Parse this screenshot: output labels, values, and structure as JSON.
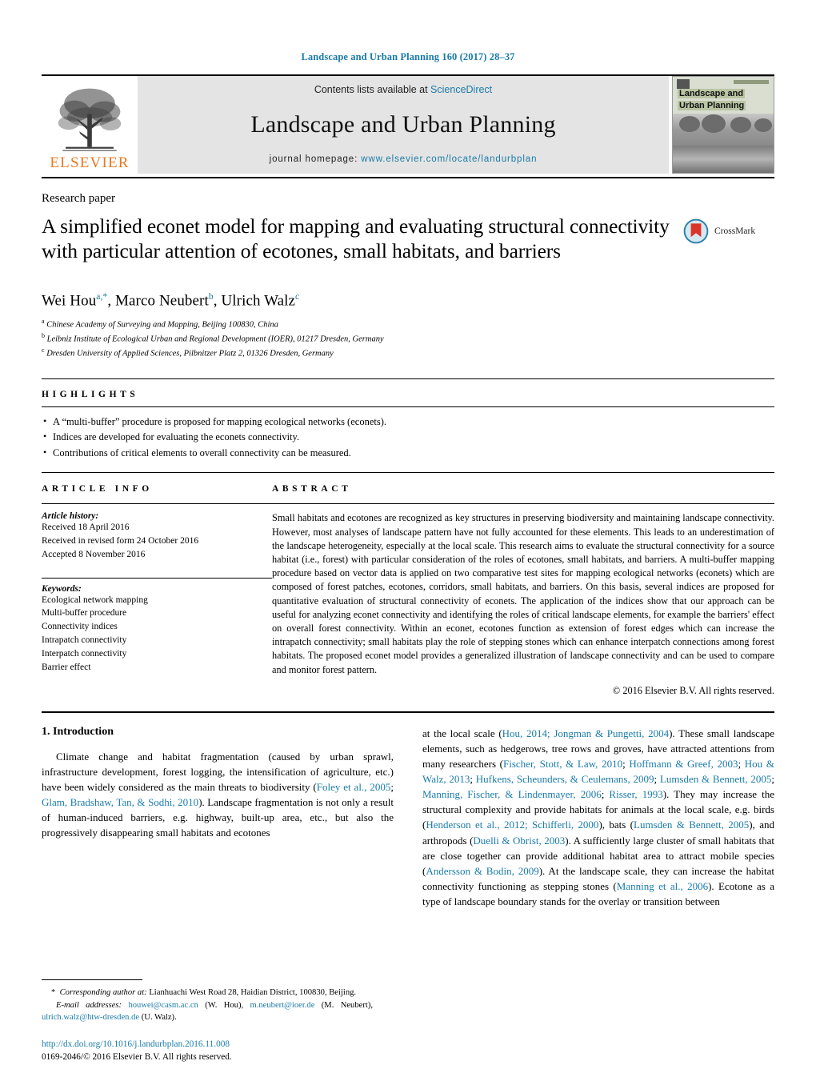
{
  "running_head": "Landscape and Urban Planning 160 (2017) 28–37",
  "masthead": {
    "publisher_name": "ELSEVIER",
    "contents_line_prefix": "Contents lists available at ",
    "contents_link": "ScienceDirect",
    "journal_title": "Landscape and Urban Planning",
    "homepage_label": "journal homepage: ",
    "homepage_url": "www.elsevier.com/locate/landurbplan",
    "cover": {
      "line1": "Landscape and",
      "line2": "Urban Planning"
    }
  },
  "article": {
    "type_label": "Research paper",
    "title": "A simplified econet model for mapping and evaluating structural connectivity with particular attention of ecotones, small habitats, and barriers",
    "crossmark_label": "CrossMark",
    "authors": [
      {
        "name": "Wei Hou",
        "marks": "a,*"
      },
      {
        "name": "Marco Neubert",
        "marks": "b"
      },
      {
        "name": "Ulrich Walz",
        "marks": "c"
      }
    ],
    "affiliations": [
      {
        "mark": "a",
        "text": "Chinese Academy of Surveying and Mapping, Beijing 100830, China"
      },
      {
        "mark": "b",
        "text": "Leibniz Institute of Ecological Urban and Regional Development (IOER), 01217 Dresden, Germany"
      },
      {
        "mark": "c",
        "text": "Dresden University of Applied Sciences, Pilbnitzer Platz 2, 01326 Dresden, Germany"
      }
    ]
  },
  "highlights": {
    "heading": "HIGHLIGHTS",
    "items": [
      "A “multi-buffer” procedure is proposed for mapping ecological networks (econets).",
      "Indices are developed for evaluating the econets connectivity.",
      "Contributions of critical elements to overall connectivity can be measured."
    ]
  },
  "article_info": {
    "heading": "ARTICLE INFO",
    "history_title": "Article history:",
    "history": [
      "Received 18 April 2016",
      "Received in revised form 24 October 2016",
      "Accepted 8 November 2016"
    ],
    "keywords_title": "Keywords:",
    "keywords": [
      "Ecological network mapping",
      "Multi-buffer procedure",
      "Connectivity indices",
      "Intrapatch connectivity",
      "Interpatch connectivity",
      "Barrier effect"
    ]
  },
  "abstract": {
    "heading": "ABSTRACT",
    "text": "Small habitats and ecotones are recognized as key structures in preserving biodiversity and maintaining landscape connectivity. However, most analyses of landscape pattern have not fully accounted for these elements. This leads to an underestimation of the landscape heterogeneity, especially at the local scale. This research aims to evaluate the structural connectivity for a source habitat (i.e., forest) with particular consideration of the roles of ecotones, small habitats, and barriers. A multi-buffer mapping procedure based on vector data is applied on two comparative test sites for mapping ecological networks (econets) which are composed of forest patches, ecotones, corridors, small habitats, and barriers. On this basis, several indices are proposed for quantitative evaluation of structural connectivity of econets. The application of the indices show that our approach can be useful for analyzing econet connectivity and identifying the roles of critical landscape elements, for example the barriers' effect on overall forest connectivity. Within an econet, ecotones function as extension of forest edges which can increase the intrapatch connectivity; small habitats play the role of stepping stones which can enhance interpatch connections among forest habitats. The proposed econet model provides a generalized illustration of landscape connectivity and can be used to compare and monitor forest pattern.",
    "copyright": "© 2016 Elsevier B.V. All rights reserved."
  },
  "body": {
    "section_number_title": "1.  Introduction",
    "left_paragraph_html": "Climate change and habitat fragmentation (caused by urban sprawl, infrastructure development, forest logging, the intensification of agriculture, etc.) have been widely considered as the main threats to biodiversity (<span class=\"ref\">Foley et al., 2005</span>; <span class=\"ref\">Glam, Bradshaw, Tan, &amp; Sodhi, 2010</span>). Landscape fragmentation is not only a result of human-induced barriers, e.g. highway, built-up area, etc., but also the progressively disappearing small habitats and ecotones",
    "right_paragraph_html": "at the local scale (<span class=\"ref\">Hou, 2014; Jongman &amp; Pungetti, 2004</span>). These small landscape elements, such as hedgerows, tree rows and groves, have attracted attentions from many researchers (<span class=\"ref\">Fischer, Stott, &amp; Law, 2010</span>; <span class=\"ref\">Hoffmann &amp; Greef, 2003</span>; <span class=\"ref\">Hou &amp; Walz, 2013</span>; <span class=\"ref\">Hufkens, Scheunders, &amp; Ceulemans, 2009</span>; <span class=\"ref\">Lumsden &amp; Bennett, 2005</span>; <span class=\"ref\">Manning, Fischer, &amp; Lindenmayer, 2006</span>; <span class=\"ref\">Risser, 1993</span>). They may increase the structural complexity and provide habitats for animals at the local scale, e.g. birds (<span class=\"ref\">Henderson et al., 2012; Schifferli, 2000</span>), bats (<span class=\"ref\">Lumsden &amp; Bennett, 2005</span>), and arthropods (<span class=\"ref\">Duelli &amp; Obrist, 2003</span>). A sufficiently large cluster of small habitats that are close together can provide additional habitat area to attract mobile species (<span class=\"ref\">Andersson &amp; Bodin, 2009</span>). At the landscape scale, they can increase the habitat connectivity functioning as stepping stones (<span class=\"ref\">Manning et al., 2006</span>). Ecotone as a type of landscape boundary stands for the overlay or transition between"
  },
  "footnote": {
    "corresponding_html": "<span style=\"letter-spacing:0\">*</span>&nbsp; <span class=\"it\">Corresponding author at:</span> Lianhuachi West Road 28, Haidian District, 100830, Beijing.",
    "emails_html": "<span class=\"it\">E-mail addresses:</span> <span class=\"ref\">houwei@casm.ac.cn</span> (W. Hou), <span class=\"ref\">m.neubert@ioer.de</span> (M. Neubert), <span class=\"ref\">ulrich.walz@htw-dresden.de</span> (U. Walz).",
    "doi": "http://dx.doi.org/10.1016/j.landurbplan.2016.11.008",
    "issn": "0169-2046/© 2016 Elsevier B.V. All rights reserved."
  },
  "colors": {
    "link": "#1a7ba8",
    "elsevier_orange": "#E87722",
    "banner_bg": "#e4e4e4"
  }
}
